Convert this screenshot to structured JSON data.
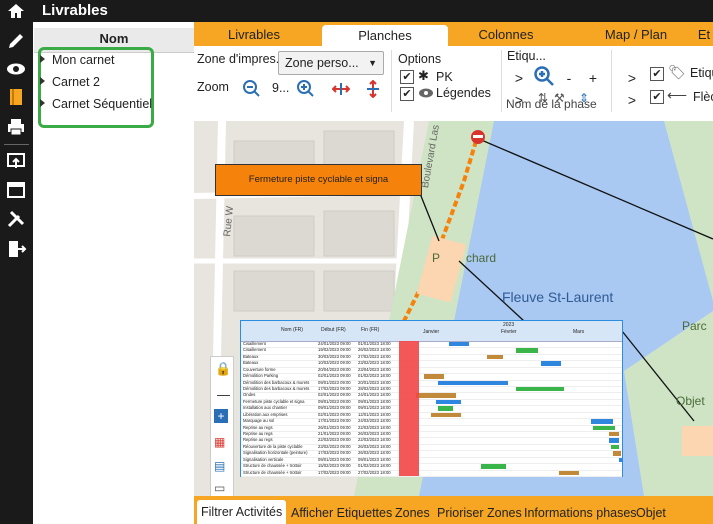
{
  "app": {
    "title": "Livrables",
    "rail_icons": [
      "home-icon",
      "pencil-icon",
      "eye-icon",
      "book-icon",
      "printer-icon",
      "export-icon",
      "calendar-icon",
      "tools-icon",
      "logout-icon"
    ]
  },
  "tree": {
    "header": "Nom",
    "items": [
      "Mon carnet",
      "Carnet 2",
      "Carnet Séquentiel"
    ],
    "highlight_color": "#3aab47"
  },
  "tabs": [
    "Livrables",
    "Planches",
    "Colonnes",
    "Map / Plan",
    "Et"
  ],
  "active_tab": "Planches",
  "ribbon": {
    "zone_label": "Zone d'impres...",
    "zone_value": "Zone perso...",
    "zoom_label": "Zoom",
    "zoom_value": "9...",
    "options_label": "Options",
    "opt_pk": "PK",
    "opt_legendes": "Légendes",
    "etiq_label": "Etiqu...",
    "etiq_cut": "Etiqu",
    "fleche_cut": "Flèc",
    "phase_name": "Nom de la phase",
    "btn_gt": ">",
    "btn_minus": "-",
    "btn_plus": "+"
  },
  "map": {
    "orange_label": "Fermeture piste cyclable et signa",
    "river_label": "Fleuve St-Laurent",
    "street1": "Rue W",
    "street2": "Boulevard Las",
    "street3": "Boulevard",
    "parc1": "P",
    "parc1b": "chard",
    "parc2": "Parc",
    "objet": "Objet",
    "colors": {
      "river": "#a9c8f2",
      "park": "#cfe4c4",
      "road": "#ffffff",
      "orange": "#f5820a"
    }
  },
  "gantt": {
    "headers": [
      "Nom (FR)",
      "Début (FR)",
      "Fin (FR)"
    ],
    "year": "2023",
    "months": [
      "Janvier",
      "Février",
      "Mars"
    ],
    "rows": [
      [
        "Cisaillement",
        "24/01/2023 09:00",
        "01/01/2023 18:00"
      ],
      [
        "Cisaillement",
        "19/02/2023 09:00",
        "26/02/2023 18:00"
      ],
      [
        "Bateaux",
        "30/03/2023 09:00",
        "27/02/2023 18:00"
      ],
      [
        "Bateaux",
        "10/03/2023 09:00",
        "23/02/2023 18:00"
      ],
      [
        "Couverture forme",
        "20/04/2023 09:00",
        "23/04/2023 18:00"
      ],
      [
        "Démolition Parking",
        "02/01/2023 09:00",
        "01/02/2023 18:00"
      ],
      [
        "Démolition des barbacoux & murets",
        "09/01/2023 09:00",
        "20/01/2023 18:00"
      ],
      [
        "Démolition des barbacoux & murets",
        "17/02/2023 09:00",
        "28/02/2023 18:00"
      ],
      [
        "Ondes",
        "02/01/2023 09:00",
        "24/01/2023 18:00"
      ],
      [
        "Fermeture piste cyclable et signa",
        "09/01/2023 09:00",
        "09/01/2023 18:00"
      ],
      [
        "Installation aux chantier",
        "09/01/2023 09:00",
        "09/01/2023 18:00"
      ],
      [
        "Libération aux emprises",
        "02/01/2023 09:00",
        "12/01/2023 18:00"
      ],
      [
        "Marquage au sol",
        "17/01/2023 09:00",
        "24/03/2023 18:00"
      ],
      [
        "Reprise au regs",
        "26/01/2023 09:00",
        "22/03/2023 18:00"
      ],
      [
        "Reprise au regs",
        "21/01/2023 09:00",
        "26/03/2023 18:00"
      ],
      [
        "Reprise au regs",
        "22/03/2023 09:00",
        "22/03/2023 18:00"
      ],
      [
        "Réouverture de la piste cyclable",
        "23/02/2023 09:00",
        "26/03/2023 18:00"
      ],
      [
        "Signalisation horizontale (peinture)",
        "17/03/2023 09:00",
        "26/03/2023 18:00"
      ],
      [
        "Signalisation verticale",
        "09/01/2023 09:00",
        "09/01/2023 18:00"
      ],
      [
        "Structure de chaussée + trottoir",
        "15/02/2023 09:00",
        "01/02/2023 18:00"
      ],
      [
        "Structure de chaussée + trottoir",
        "17/02/2023 09:00",
        "27/02/2023 18:00"
      ]
    ],
    "bar_labels": [
      "Cisaillement",
      "Cisaillement",
      "Bateaux",
      "Bateaux",
      "Démolition Parking",
      "Démol fon des barbacoux & murets",
      "Démolition des barbacoux & murets",
      "Démolition Parking",
      "Installation aux chantier",
      "Libération aux emprises",
      "Reprise au regs",
      "Reprise au regs",
      "Rés",
      "Structure de chaussée + trottoir",
      "Structure de chaussée + trottoir"
    ]
  },
  "bottom_tabs": [
    "Filtrer Activités",
    "Afficher Etiquettes",
    "Zones",
    "Prioriser Zones",
    "Informations phases",
    "Objet"
  ],
  "active_bottom_tab": "Filtrer Activités"
}
